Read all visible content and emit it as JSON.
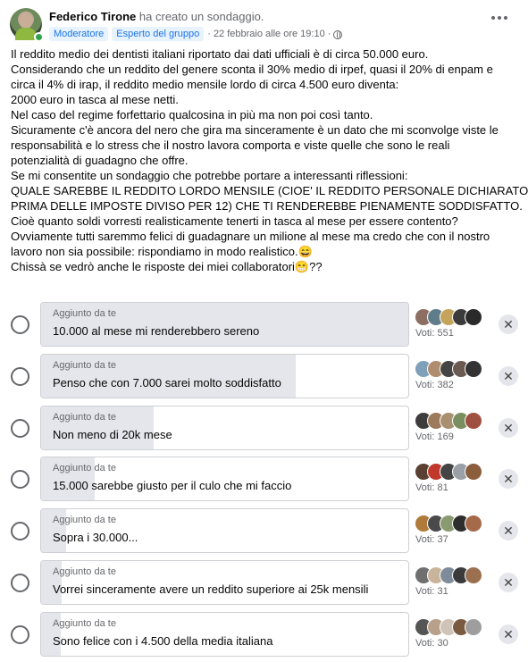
{
  "post": {
    "author": "Federico Tirone",
    "action": "ha creato un sondaggio.",
    "badges": [
      "Moderatore",
      "Esperto del gruppo"
    ],
    "timestamp": "· 22 febbraio alle ore 19:10 ·",
    "body_lines": [
      "Il reddito medio dei dentisti italiani riportato dai dati ufficiali è di circa 50.000 euro.",
      "Considerando che un reddito del genere sconta il 30% medio di irpef, quasi il 20% di enpam e",
      "circa il 4% di irap, il reddito medio mensile lordo di circa 4.500 euro diventa:",
      "2000 euro in tasca al mese netti.",
      "Nel caso del regime forfettario qualcosina in più ma non poi così tanto.",
      "Sicuramente c'è ancora del nero che gira ma sinceramente è un dato che mi sconvolge viste le",
      "responsabilità e lo stress che il nostro lavora comporta e viste quelle che sono le reali",
      "potenzialità di guadagno che offre.",
      "Se mi consentite un sondaggio che potrebbe portare a interessanti riflessioni:",
      "QUALE SAREBBE IL REDDITO LORDO MENSILE (CIOE' IL REDDITO PERSONALE DICHIARATO",
      "PRIMA DELLE IMPOSTE DIVISO PER 12) CHE TI RENDEREBBE PIENAMENTE SODDISFATTO.",
      "Cioè quanto soldi vorresti realisticamente tenerti in tasca al mese per essere  contento?",
      "Ovviamente tutti saremmo felici di guadagnare un milione al mese ma credo che con il nostro",
      "lavoro non sia possibile: rispondiamo in modo realistico.😄",
      "Chissà se vedrò anche le risposte dei miei collaboratori😁??"
    ]
  },
  "poll": {
    "options": [
      {
        "added_by": "Aggiunto da te",
        "text": "10.000 al mese mi renderebbero sereno",
        "votes": "Voti: 551",
        "fill": 1.0
      },
      {
        "added_by": "Aggiunto da te",
        "text": "Penso che con 7.000 sarei molto soddisfatto",
        "votes": "Voti: 382",
        "fill": 0.693
      },
      {
        "added_by": "Aggiunto da te",
        "text": "Non meno di 20k mese",
        "votes": "Voti: 169",
        "fill": 0.307
      },
      {
        "added_by": "Aggiunto da te",
        "text": "15.000 sarebbe giusto per il culo che mi faccio",
        "votes": "Voti: 81",
        "fill": 0.147
      },
      {
        "added_by": "Aggiunto da te",
        "text": "Sopra i 30.000...",
        "votes": "Voti: 37",
        "fill": 0.067
      },
      {
        "added_by": "Aggiunto da te",
        "text": "Vorrei sinceramente avere un reddito superiore ai 25k mensili",
        "votes": "Voti: 31",
        "fill": 0.056
      },
      {
        "added_by": "Aggiunto da te",
        "text": "Sono felice con i 4.500 della media italiana",
        "votes": "Voti: 30",
        "fill": 0.054
      }
    ]
  },
  "colors": {
    "badge_bg": "#e7f3ff",
    "badge_text": "#1b74e4",
    "fill": "#e4e6eb",
    "online": "#31a24c"
  },
  "icons": {
    "more": "more-options-icon",
    "remove": "close-icon",
    "privacy": "globe-icon"
  }
}
